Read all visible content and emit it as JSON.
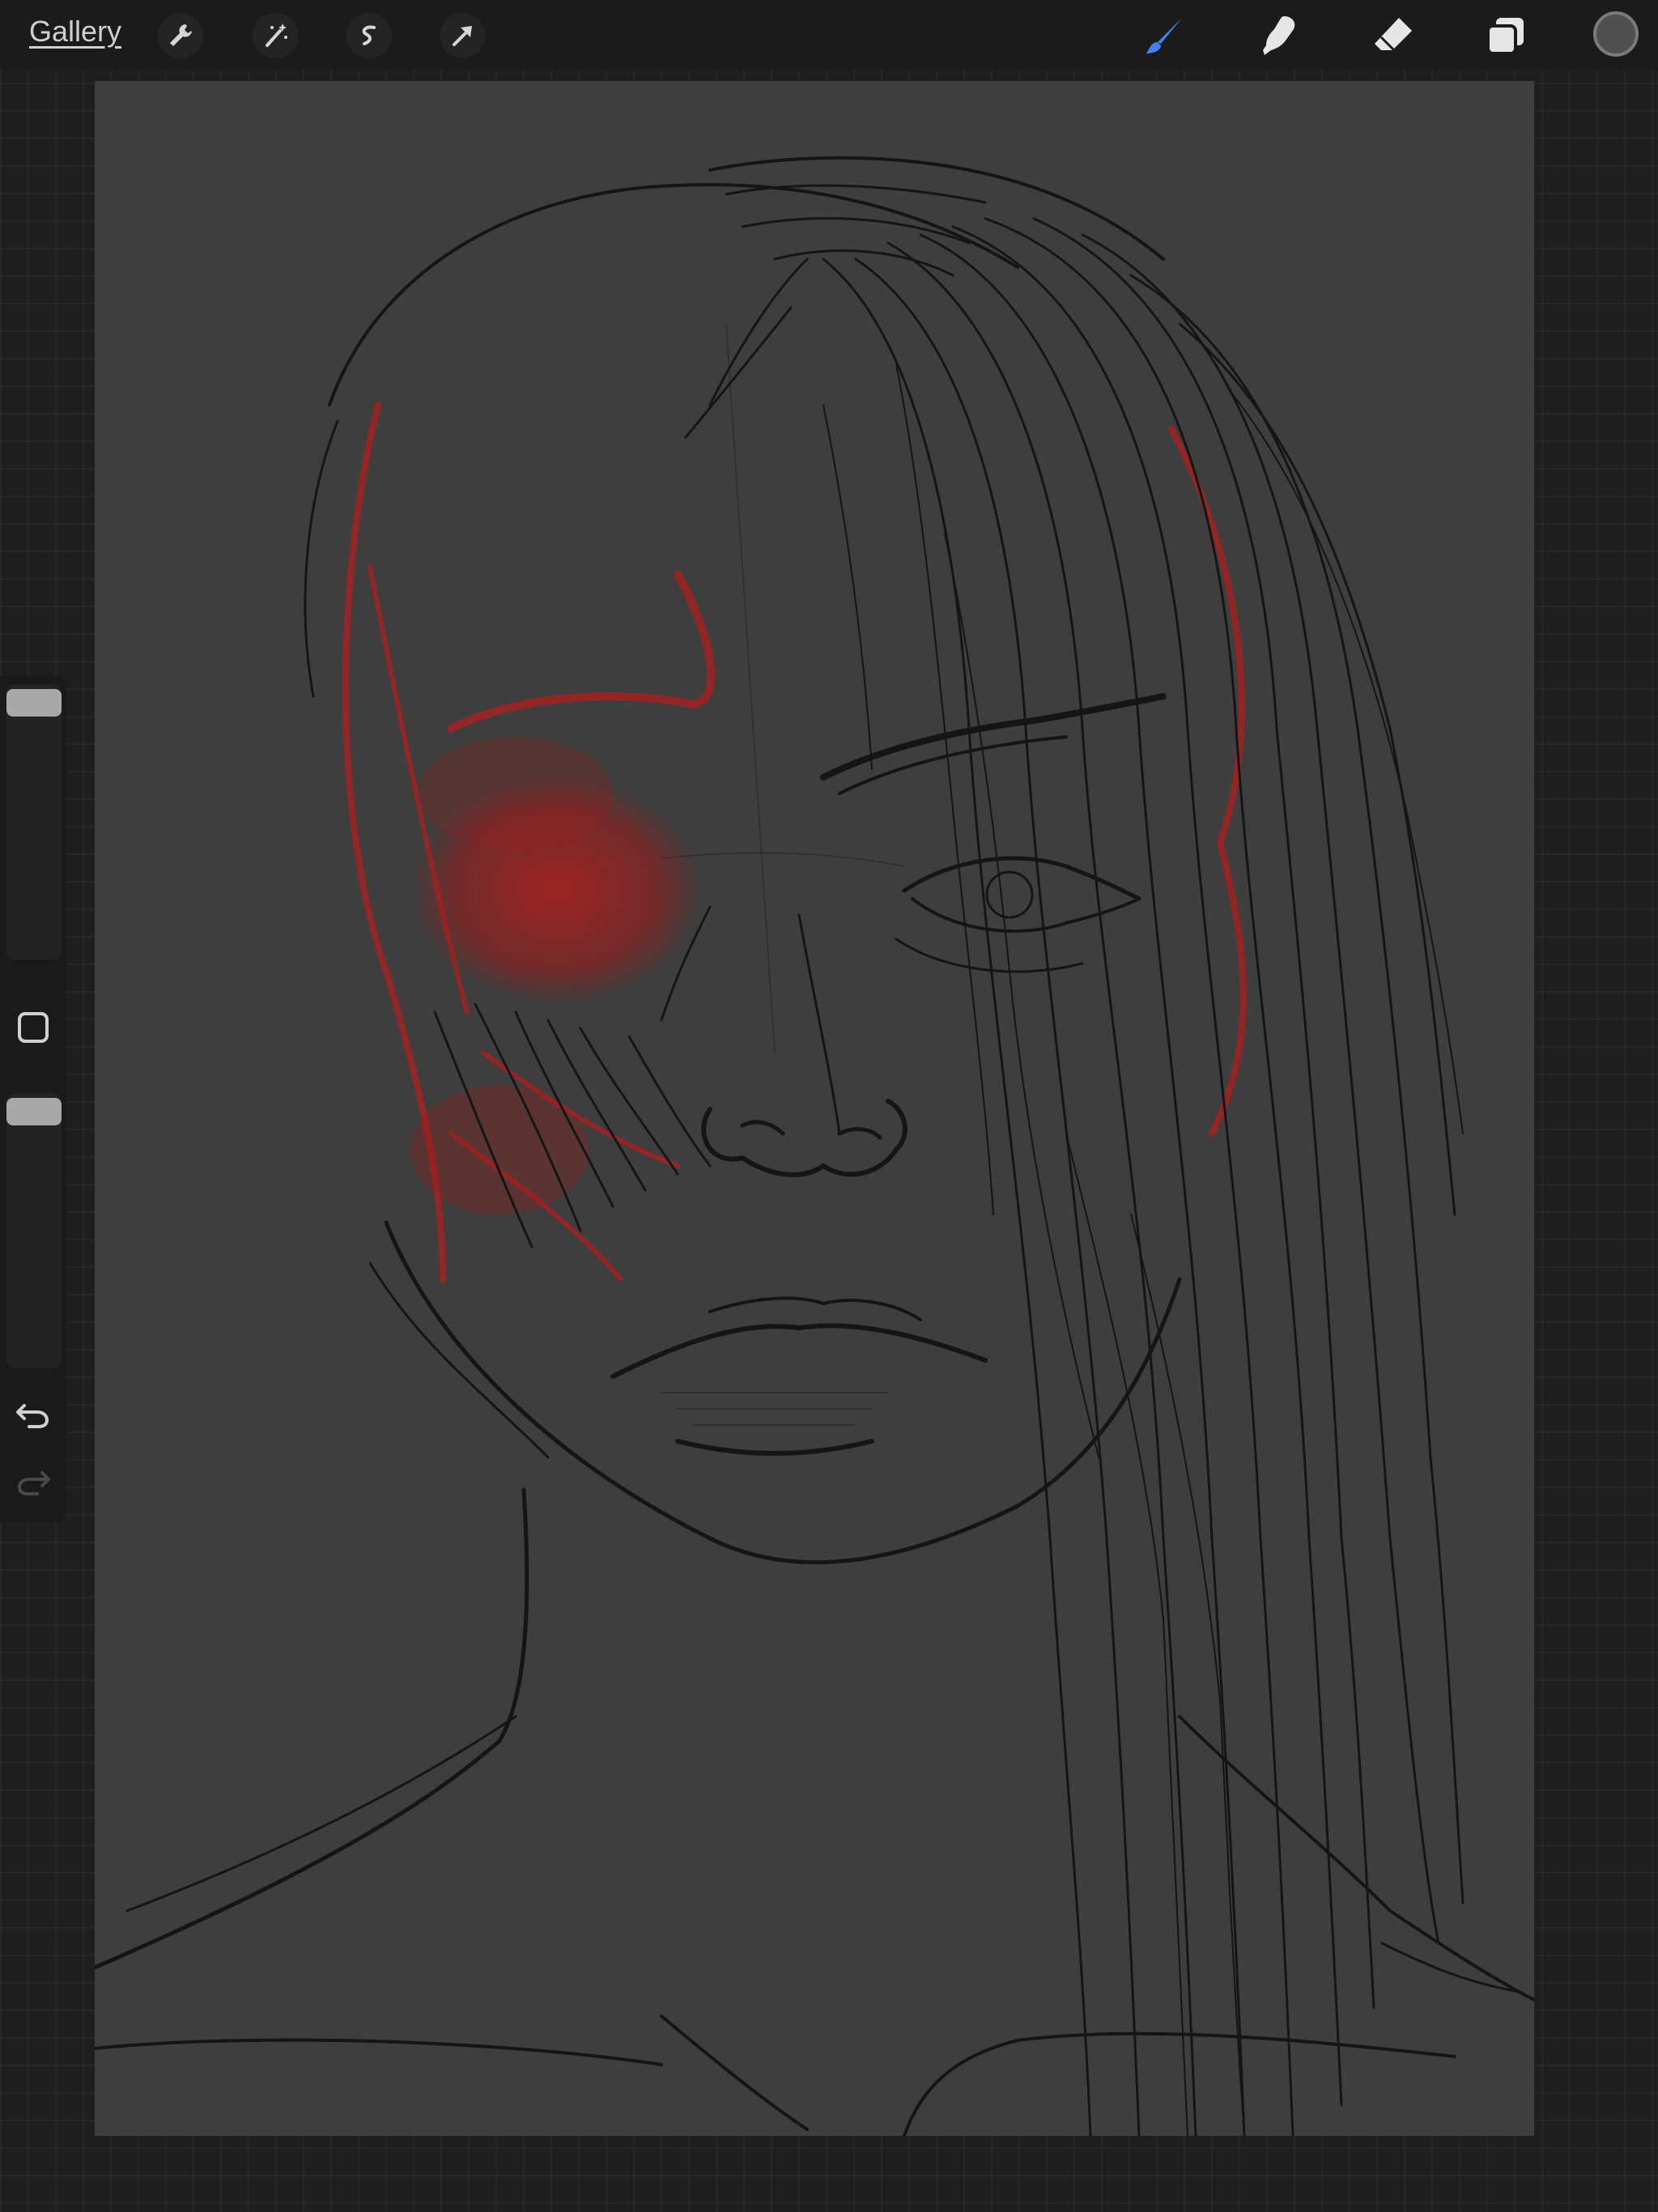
{
  "toolbar": {
    "gallery_label": "Gallery",
    "left_icons": [
      "wrench-icon",
      "magic-wand-icon",
      "selection-icon",
      "transform-arrow-icon"
    ],
    "right_icons": [
      "brush-icon",
      "smudge-icon",
      "eraser-icon",
      "layers-icon"
    ],
    "active_tool": "brush",
    "accent_color": "#3f82f0",
    "current_color": "#505050"
  },
  "sidebar": {
    "brush_size_level": 0.96,
    "opacity_level": 0.96
  },
  "colors": {
    "canvas_background": "#3e3e3e",
    "sketch_line": "#151515",
    "sketch_red": "#b01e1e"
  }
}
